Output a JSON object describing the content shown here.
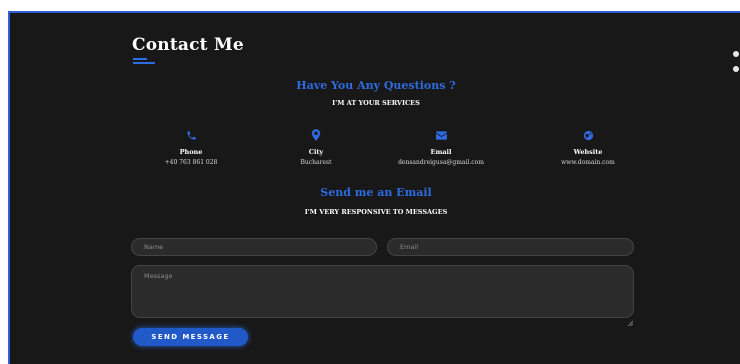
{
  "page": {
    "title": "Contact Me"
  },
  "questions": {
    "heading": "Have You Any Questions ?",
    "subheading": "I'M AT YOUR SERVICES"
  },
  "info": [
    {
      "icon": "phone-icon",
      "label": "Phone",
      "value": "+40 763 861 028"
    },
    {
      "icon": "location-pin-icon",
      "label": "City",
      "value": "Bucharest"
    },
    {
      "icon": "envelope-icon",
      "label": "Email",
      "value": "densandreigusa@gmail.com"
    },
    {
      "icon": "globe-icon",
      "label": "Website",
      "value": "www.domain.com"
    }
  ],
  "email_section": {
    "heading": "Send me an Email",
    "subheading": "I'M VERY RESPONSIVE TO MESSAGES"
  },
  "form": {
    "name_placeholder": "Name",
    "email_placeholder": "Email",
    "message_placeholder": "Message",
    "submit_label": "SEND MESSAGE"
  },
  "colors": {
    "accent": "#2f6be0",
    "background": "#181818",
    "field_bg": "#2b2b2b"
  }
}
